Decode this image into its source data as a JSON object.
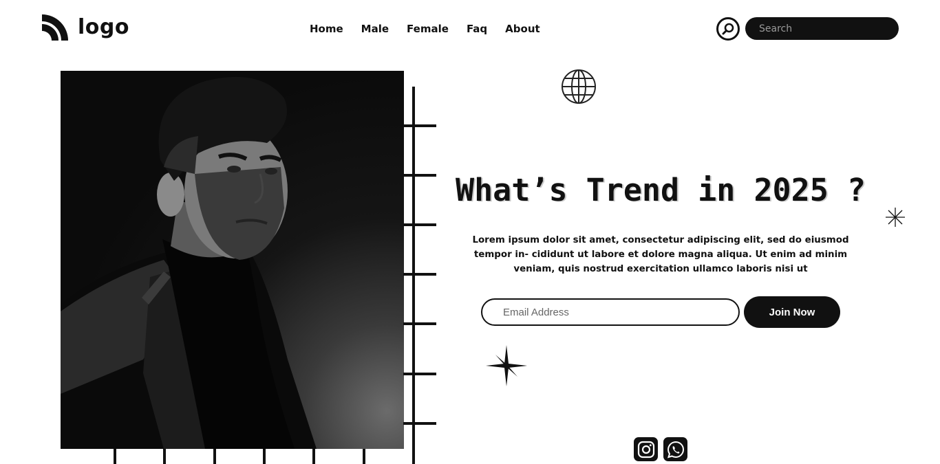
{
  "header": {
    "logo_text": "logo",
    "nav": [
      "Home",
      "Male",
      "Female",
      "Faq",
      "About"
    ],
    "search_placeholder": "Search"
  },
  "hero": {
    "headline": "What’s Trend in 2025 ?",
    "lede": "Lorem ipsum dolor sit amet, consectetur adipiscing elit, sed do eiusmod tempor in- cididunt ut labore et dolore magna aliqua. Ut enim ad minim veniam, quis nostrud exercitation ullamco laboris nisi ut",
    "email_placeholder": "Email Address",
    "join_label": "Join Now"
  },
  "social": [
    "instagram-icon",
    "whatsapp-icon"
  ],
  "colors": {
    "ink": "#111111",
    "background": "#ffffff"
  }
}
